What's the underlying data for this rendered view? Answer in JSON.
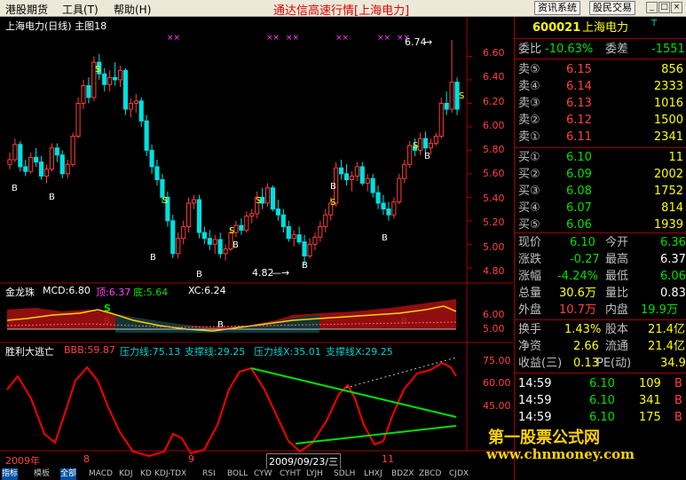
{
  "menu": {
    "item1": "港股期货",
    "item2": "工具(T)",
    "item3": "帮助(H)",
    "title": "通达信高速行情[上海电力]",
    "btn1": "资讯系统",
    "btn2": "股民交易"
  },
  "chart": {
    "title": "上海电力(日线) 主图18",
    "price_axis": [
      "6.60",
      "6.40",
      "6.20",
      "6.00",
      "5.80",
      "5.60",
      "5.40",
      "5.20",
      "5.00",
      "4.80"
    ],
    "high_label": "6.74",
    "low_label": "4.82",
    "sub1_label": "金龙珠",
    "sub1_mcd": "MCD:6.80",
    "sub1_top": "顶:6.37",
    "sub1_bottom": "底:5.64",
    "sub1_xc": "XC:6.24",
    "sub1_axis": [
      "6.00",
      "5.00"
    ],
    "sub2_label": "胜利大逃亡",
    "sub2_bbb": "BBB:59.87",
    "sub2_press": "压力线:75.13",
    "sub2_support": "支撑线:29.25",
    "sub2_pressx": "压力线X:35.01",
    "sub2_supportx": "支撑线X:29.25",
    "sub2_axis": [
      "75.00",
      "60.00",
      "45.00"
    ],
    "date_left": "2009年",
    "date_m8": "8",
    "date_m9": "9",
    "date_cursor": "2009/09/23/三",
    "date_m11": "11"
  },
  "chart_data": {
    "type": "candlestick",
    "ylim": [
      4.7,
      6.8
    ],
    "candles": [
      [
        5.68,
        5.78,
        5.64,
        5.72
      ],
      [
        5.72,
        5.9,
        5.7,
        5.85
      ],
      [
        5.85,
        5.88,
        5.62,
        5.66
      ],
      [
        5.66,
        5.72,
        5.58,
        5.62
      ],
      [
        5.62,
        5.78,
        5.6,
        5.74
      ],
      [
        5.74,
        5.82,
        5.66,
        5.7
      ],
      [
        5.7,
        5.75,
        5.55,
        5.58
      ],
      [
        5.58,
        5.68,
        5.52,
        5.64
      ],
      [
        5.64,
        5.86,
        5.62,
        5.82
      ],
      [
        5.82,
        5.86,
        5.7,
        5.76
      ],
      [
        5.76,
        5.8,
        5.56,
        5.6
      ],
      [
        5.6,
        5.72,
        5.56,
        5.68
      ],
      [
        5.68,
        5.95,
        5.66,
        5.92
      ],
      [
        5.92,
        6.25,
        5.9,
        6.2
      ],
      [
        6.2,
        6.4,
        6.15,
        6.35
      ],
      [
        6.35,
        6.42,
        6.2,
        6.25
      ],
      [
        6.25,
        6.6,
        6.22,
        6.55
      ],
      [
        6.55,
        6.62,
        6.4,
        6.45
      ],
      [
        6.45,
        6.5,
        6.3,
        6.36
      ],
      [
        6.36,
        6.48,
        6.3,
        6.42
      ],
      [
        6.42,
        6.55,
        6.35,
        6.4
      ],
      [
        6.4,
        6.52,
        6.34,
        6.48
      ],
      [
        6.48,
        6.5,
        6.1,
        6.15
      ],
      [
        6.15,
        6.24,
        6.08,
        6.2
      ],
      [
        6.2,
        6.28,
        6.12,
        6.22
      ],
      [
        6.22,
        6.25,
        6.0,
        6.05
      ],
      [
        6.05,
        6.1,
        5.75,
        5.8
      ],
      [
        5.8,
        5.85,
        5.6,
        5.66
      ],
      [
        5.66,
        5.72,
        5.5,
        5.55
      ],
      [
        5.55,
        5.6,
        5.35,
        5.4
      ],
      [
        5.4,
        5.45,
        5.15,
        5.2
      ],
      [
        5.2,
        5.25,
        4.88,
        4.92
      ],
      [
        4.92,
        5.1,
        4.88,
        5.05
      ],
      [
        5.05,
        5.2,
        5.0,
        5.15
      ],
      [
        5.15,
        5.4,
        5.1,
        5.35
      ],
      [
        5.35,
        5.42,
        5.3,
        5.38
      ],
      [
        5.38,
        5.42,
        5.05,
        5.1
      ],
      [
        5.1,
        5.15,
        5.0,
        5.05
      ],
      [
        5.05,
        5.12,
        4.95,
        5.0
      ],
      [
        5.0,
        5.08,
        4.92,
        5.04
      ],
      [
        5.04,
        5.1,
        4.88,
        4.92
      ],
      [
        4.92,
        5.0,
        4.86,
        4.96
      ],
      [
        4.96,
        5.14,
        4.94,
        5.1
      ],
      [
        5.1,
        5.2,
        5.06,
        5.16
      ],
      [
        5.16,
        5.22,
        5.08,
        5.12
      ],
      [
        5.12,
        5.28,
        5.1,
        5.24
      ],
      [
        5.24,
        5.3,
        5.18,
        5.26
      ],
      [
        5.26,
        5.45,
        5.22,
        5.4
      ],
      [
        5.4,
        5.48,
        5.3,
        5.35
      ],
      [
        5.35,
        5.52,
        5.32,
        5.48
      ],
      [
        5.48,
        5.5,
        5.28,
        5.3
      ],
      [
        5.3,
        5.38,
        5.2,
        5.25
      ],
      [
        5.25,
        5.3,
        5.1,
        5.15
      ],
      [
        5.15,
        5.2,
        5.02,
        5.05
      ],
      [
        5.05,
        5.12,
        4.98,
        5.08
      ],
      [
        5.08,
        5.15,
        5.0,
        5.02
      ],
      [
        5.02,
        5.08,
        4.82,
        4.9
      ],
      [
        4.9,
        5.05,
        4.88,
        5.0
      ],
      [
        5.0,
        5.1,
        4.95,
        5.06
      ],
      [
        5.06,
        5.2,
        5.02,
        5.15
      ],
      [
        5.15,
        5.3,
        5.1,
        5.25
      ],
      [
        5.25,
        5.4,
        5.2,
        5.35
      ],
      [
        5.35,
        5.7,
        5.32,
        5.65
      ],
      [
        5.65,
        5.72,
        5.55,
        5.6
      ],
      [
        5.6,
        5.68,
        5.5,
        5.55
      ],
      [
        5.55,
        5.62,
        5.45,
        5.58
      ],
      [
        5.58,
        5.7,
        5.54,
        5.66
      ],
      [
        5.66,
        5.7,
        5.5,
        5.52
      ],
      [
        5.52,
        5.6,
        5.45,
        5.56
      ],
      [
        5.56,
        5.6,
        5.4,
        5.44
      ],
      [
        5.44,
        5.5,
        5.3,
        5.35
      ],
      [
        5.35,
        5.42,
        5.25,
        5.3
      ],
      [
        5.3,
        5.36,
        5.2,
        5.25
      ],
      [
        5.25,
        5.4,
        5.22,
        5.36
      ],
      [
        5.36,
        5.6,
        5.34,
        5.56
      ],
      [
        5.56,
        5.72,
        5.52,
        5.68
      ],
      [
        5.68,
        5.88,
        5.65,
        5.84
      ],
      [
        5.84,
        5.9,
        5.75,
        5.8
      ],
      [
        5.8,
        5.95,
        5.76,
        5.9
      ],
      [
        5.9,
        5.96,
        5.78,
        5.82
      ],
      [
        5.82,
        5.9,
        5.76,
        5.86
      ],
      [
        5.86,
        5.95,
        5.84,
        5.92
      ],
      [
        5.92,
        6.25,
        5.9,
        6.2
      ],
      [
        6.2,
        6.3,
        6.1,
        6.15
      ],
      [
        6.15,
        6.74,
        6.12,
        6.38
      ],
      [
        6.38,
        6.42,
        6.1,
        6.15
      ]
    ]
  },
  "info": {
    "code": "600021",
    "name": "上海电力",
    "mark": "T",
    "weibi_label": "委比",
    "weibi": "-10.63%",
    "weicha_label": "委差",
    "weicha": "-1551",
    "sells": [
      {
        "label": "卖⑤",
        "price": "6.15",
        "vol": "856"
      },
      {
        "label": "卖④",
        "price": "6.14",
        "vol": "2333"
      },
      {
        "label": "卖③",
        "price": "6.13",
        "vol": "1016"
      },
      {
        "label": "卖②",
        "price": "6.12",
        "vol": "1500"
      },
      {
        "label": "卖①",
        "price": "6.11",
        "vol": "2341"
      }
    ],
    "buys": [
      {
        "label": "买①",
        "price": "6.10",
        "vol": "11"
      },
      {
        "label": "买②",
        "price": "6.09",
        "vol": "2002"
      },
      {
        "label": "买③",
        "price": "6.08",
        "vol": "1752"
      },
      {
        "label": "买④",
        "price": "6.07",
        "vol": "814"
      },
      {
        "label": "买⑤",
        "price": "6.06",
        "vol": "1939"
      }
    ],
    "xianjia_label": "现价",
    "xianjia": "6.10",
    "jinkai_label": "今开",
    "jinkai": "6.36",
    "zhangdie_label": "涨跌",
    "zhangdie": "-0.27",
    "zuigao_label": "最高",
    "zuigao": "6.37",
    "zhangfu_label": "涨幅",
    "zhangfu": "-4.24%",
    "zuidi_label": "最低",
    "zuidi": "6.06",
    "zongliang_label": "总量",
    "zongliang": "30.6万",
    "liangbi_label": "量比",
    "liangbi": "0.83",
    "waipan_label": "外盘",
    "waipan": "10.7万",
    "neipan_label": "内盘",
    "neipan": "19.9万",
    "huanshou_label": "换手",
    "huanshou": "1.43%",
    "guben_label": "股本",
    "guben": "21.4亿",
    "jingzi_label": "净资",
    "jingzi": "2.66",
    "liutong_label": "流通",
    "liutong": "21.4亿",
    "shouyi_label": "收益(三)",
    "shouyi": "0.13",
    "pe_label": "PE(动)",
    "pe": "34.9",
    "ticks": [
      {
        "time": "14:59",
        "price": "6.10",
        "vol": "109",
        "dir": "B"
      },
      {
        "time": "14:59",
        "price": "6.10",
        "vol": "341",
        "dir": "B"
      },
      {
        "time": "14:59",
        "price": "6.10",
        "vol": "175",
        "dir": "B"
      }
    ]
  },
  "tabs": [
    "指标",
    "模板",
    "全部",
    "MACD",
    "KDJ",
    "KD",
    "KDJ-TDX",
    "RSI",
    "BOLL",
    "CYW",
    "CYHT",
    "LYJH",
    "SDLH",
    "LHXJ",
    "BDZX",
    "ZBCD",
    "CJDX"
  ],
  "watermark": {
    "line1": "第一股票公式网",
    "line2": "www.chnmoney.com"
  }
}
